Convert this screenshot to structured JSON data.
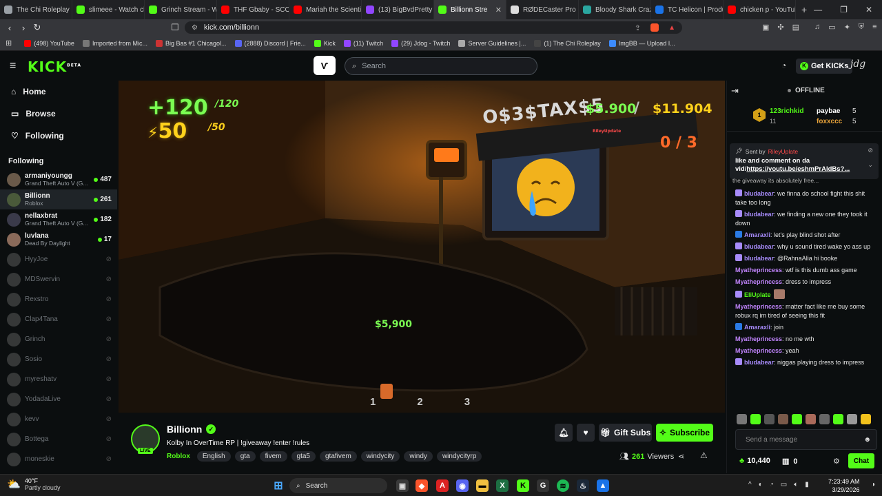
{
  "tabs": [
    {
      "label": "The Chi Roleplay",
      "color": "#9aa0a6"
    },
    {
      "label": "slimeee - Watch clip",
      "color": "#53fc18"
    },
    {
      "label": "Grinch Stream - Wa",
      "color": "#53fc18"
    },
    {
      "label": "THF Gbaby - SCOO",
      "color": "#ff0000"
    },
    {
      "label": "Mariah the Scientis",
      "color": "#ff0000"
    },
    {
      "label": "(13) BigBvdPretty",
      "color": "#9146ff"
    },
    {
      "label": "Billionn Stre",
      "color": "#53fc18",
      "active": true
    },
    {
      "label": "RØDECaster Pro | R",
      "color": "#dddddd"
    },
    {
      "label": "Bloody Shark Crazy",
      "color": "#2aa6a0"
    },
    {
      "label": "TC Helicon | Produc",
      "color": "#1a73e8"
    },
    {
      "label": "chicken p - YouTub",
      "color": "#ff0000"
    }
  ],
  "address": {
    "url": "kick.com/billionn"
  },
  "bookmarks": [
    {
      "label": "(498) YouTube",
      "color": "#ff0000"
    },
    {
      "label": "Imported from Mic...",
      "color": "#777777"
    },
    {
      "label": "Big Bas #1 Chicagol...",
      "color": "#cc3333"
    },
    {
      "label": "(2888) Discord | Frie...",
      "color": "#5865f2"
    },
    {
      "label": "Kick",
      "color": "#53fc18"
    },
    {
      "label": "(11) Twitch",
      "color": "#9146ff"
    },
    {
      "label": "(29) Jdog - Twitch",
      "color": "#9146ff"
    },
    {
      "label": "Server Guidelines |...",
      "color": "#aaaaaa"
    },
    {
      "label": "(1) The Chi Roleplay",
      "color": "#444444"
    },
    {
      "label": "ImgBB — Upload I...",
      "color": "#3d8bfd"
    }
  ],
  "header": {
    "logo": "KICK",
    "beta": "BETA",
    "search_placeholder": "Search",
    "get_kicks": "Get KICKs"
  },
  "nav": {
    "home": "Home",
    "browse": "Browse",
    "following": "Following"
  },
  "following": {
    "heading": "Following",
    "live": [
      {
        "name": "armaniyoungg",
        "game": "Grand Theft Auto V (G...",
        "viewers": "487"
      },
      {
        "name": "Billionn",
        "game": "Roblox",
        "viewers": "261",
        "active": true
      },
      {
        "name": "nellaxbrat",
        "game": "Grand Theft Auto V (G...",
        "viewers": "182"
      },
      {
        "name": "luvlana",
        "game": "Dead By Daylight",
        "viewers": "17"
      }
    ],
    "offline": [
      "HyyJoe",
      "MDSwervin",
      "Rexstro",
      "Clap4Tana",
      "Grinch",
      "Sosio",
      "myreshatv",
      "YodadaLive",
      "kevv",
      "Bottega",
      "moneskie"
    ]
  },
  "video_hud": {
    "health": "+120",
    "health_max": "/120",
    "armor": "50",
    "armor_max": "/50",
    "cash_sign": "O$3$TAX$5",
    "money": "$5.900",
    "money_total": "$11.904",
    "score": "0 / 3",
    "floor_money": "$5,900",
    "slots": [
      "1",
      "2",
      "3"
    ],
    "nametag": "RileyUpdate"
  },
  "stream": {
    "name": "Billionn",
    "live": "LIVE",
    "title": "Kolby In OverTime RP | !giveaway !enter !rules",
    "category": "Roblox",
    "tags": [
      "English",
      "gta",
      "fivem",
      "gta5",
      "gtafivem",
      "windycity",
      "windy",
      "windycityrp"
    ],
    "viewers": "261",
    "viewers_label": "Viewers",
    "gift_subs": "Gift Subs",
    "subscribe": "Subscribe"
  },
  "chat": {
    "status": "OFFLINE",
    "leaderboard": [
      {
        "name": "123richkid",
        "count": "11",
        "rank": "1"
      },
      {
        "name": "paybae",
        "count": "5"
      },
      {
        "name": "foxxccc",
        "count": "5"
      }
    ],
    "pinned": {
      "sent_by": "Sent by",
      "user": "RileyUplate",
      "text": "like and comment on da vid/",
      "link": "https://youtu.be/eshmPrAldBs?..."
    },
    "partial": "the giveaway its absolutely free...",
    "messages": [
      {
        "user": "bludabear",
        "color": "#a78bfa",
        "text": "we finna do school fight this shit take too long"
      },
      {
        "user": "bludabear",
        "color": "#a78bfa",
        "text": "we finding a new one they took it down"
      },
      {
        "user": "Amaraxli",
        "color": "#a78bfa",
        "text": "let's play blind shot after"
      },
      {
        "user": "bludabear",
        "color": "#a78bfa",
        "text": "why u sound tired wake yo ass up"
      },
      {
        "user": "bludabear",
        "color": "#a78bfa",
        "text": "@RahnaAlia hi booke"
      },
      {
        "user": "Myatheprincess",
        "color": "#c084fc",
        "text": "wtf is this dumb ass game"
      },
      {
        "user": "Myatheprincess",
        "color": "#c084fc",
        "text": "dress to impress"
      },
      {
        "user": "EliUplate",
        "color": "#53fc18",
        "text": ""
      },
      {
        "user": "Myatheprincess",
        "color": "#c084fc",
        "text": "matter fact like me buy some robux rq im tired of seeing this fit"
      },
      {
        "user": "Amaraxli",
        "color": "#a78bfa",
        "text": "join"
      },
      {
        "user": "Myatheprincess",
        "color": "#c084fc",
        "text": "no me wth"
      },
      {
        "user": "Myatheprincess",
        "color": "#c084fc",
        "text": "yeah"
      },
      {
        "user": "bludabear",
        "color": "#a78bfa",
        "text": "niggas playing dress to impress"
      }
    ],
    "input_placeholder": "Send a message",
    "points": "10,440",
    "gifts": "0",
    "chat_button": "Chat"
  },
  "taskbar": {
    "weather_temp": "40°F",
    "weather_desc": "Partly cloudy",
    "search": "Search",
    "time": "7:23:49 AM",
    "date": "3/29/2026"
  },
  "colors": {
    "kick_green": "#53fc18",
    "bg": "#0b0e0f",
    "accent_purple": "#a78bfa"
  }
}
